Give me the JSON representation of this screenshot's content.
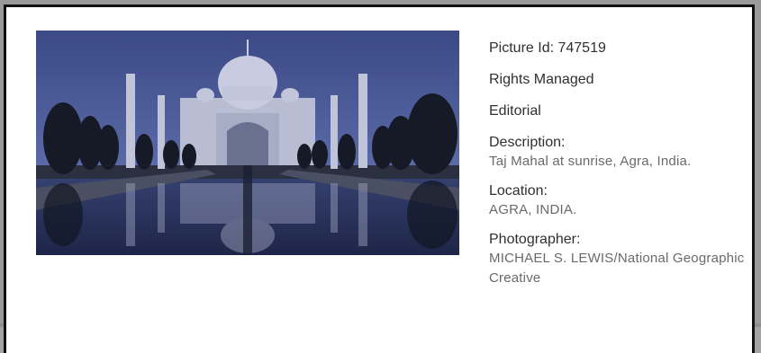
{
  "picture": {
    "picture_id_label": "Picture Id: 747519",
    "rights": "Rights Managed",
    "category": "Editorial"
  },
  "details": [
    {
      "label": "Description:",
      "value": "Taj Mahal at sunrise, Agra, India."
    },
    {
      "label": "Location:",
      "value": "AGRA, INDIA."
    },
    {
      "label": "Photographer:",
      "value": "MICHAEL S. LEWIS/National Geographic Creative"
    }
  ],
  "colors": {
    "label": "#2f2f2f",
    "value": "#6a6a6a",
    "border": "#111111",
    "background": "#9a9a9a"
  },
  "icons": [
    "taj-mahal-photo"
  ]
}
